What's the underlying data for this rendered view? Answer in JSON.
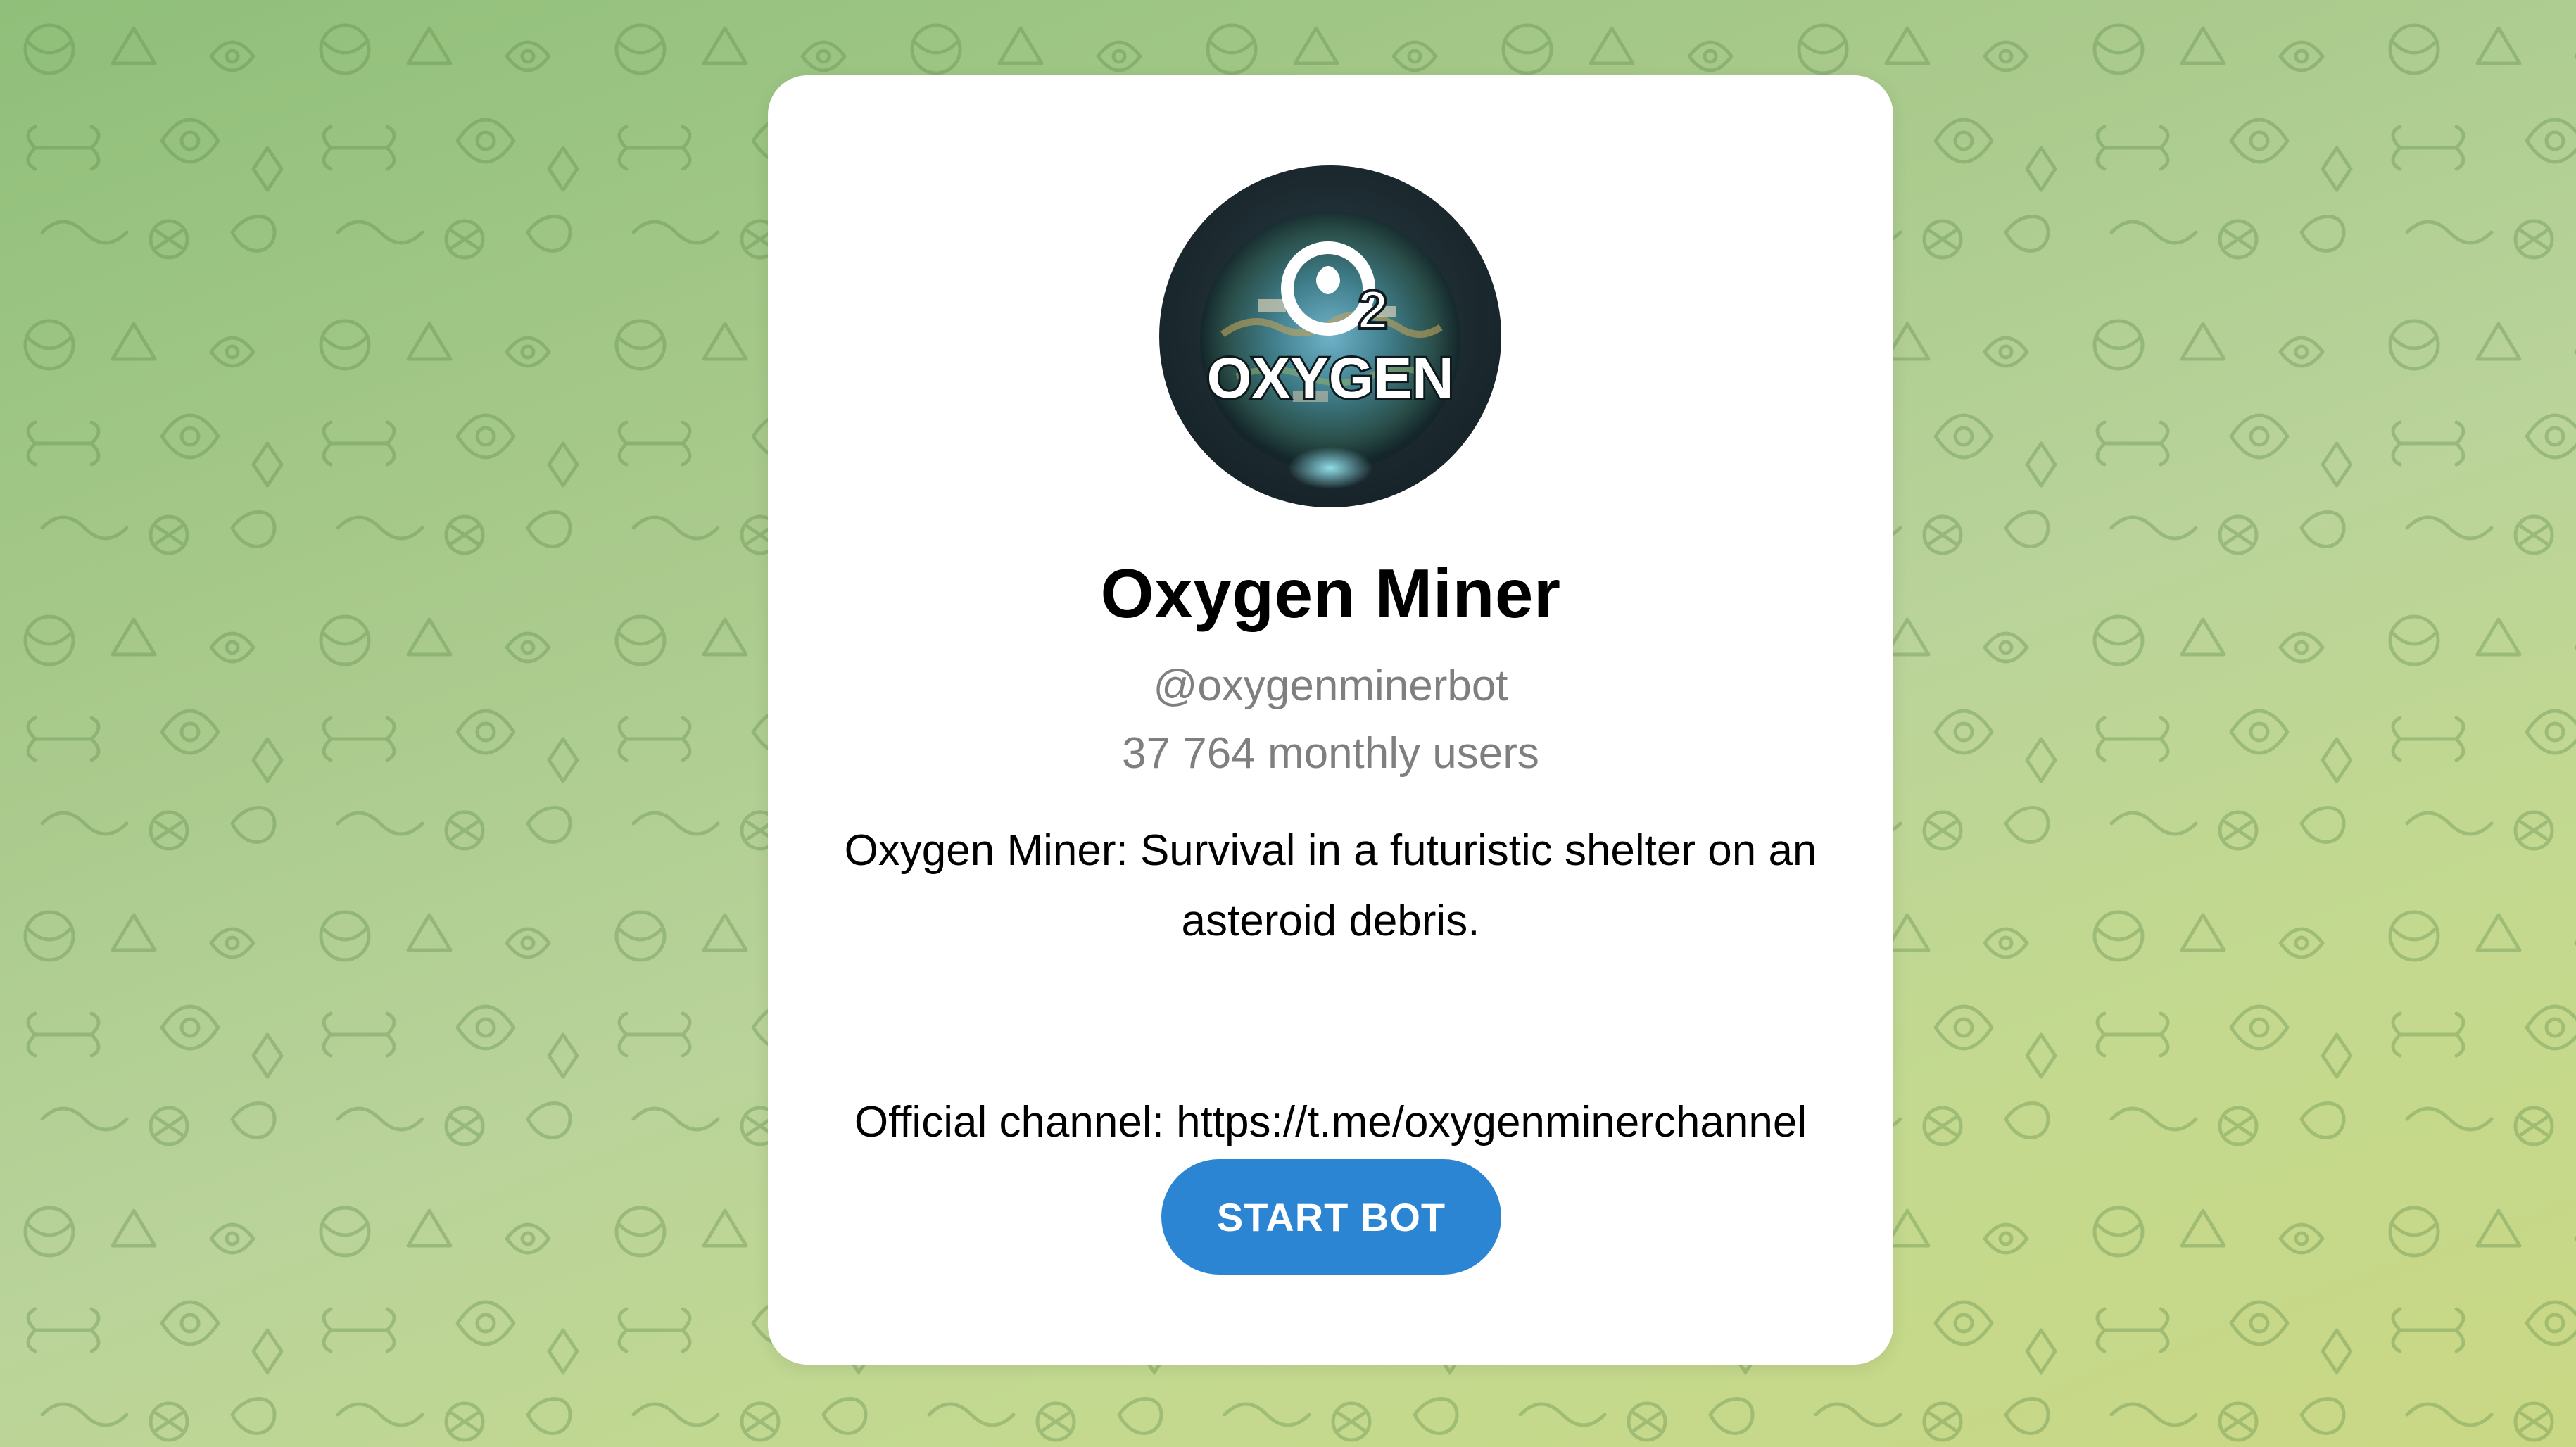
{
  "bot": {
    "avatar_text": "OXYGEN",
    "avatar_logo": "O2",
    "name": "Oxygen Miner",
    "username": "@oxygenminerbot",
    "monthly_users": "37 764 monthly users",
    "description": "Oxygen Miner: Survival in a futuristic shelter on an asteroid debris.",
    "channel_text": "Official channel: https://t.me/oxygenminerchannel"
  },
  "actions": {
    "start_label": "START BOT"
  },
  "colors": {
    "button": "#2b85d3",
    "background_start": "#8fbf7a",
    "background_end": "#c9d884",
    "muted_text": "#7f7f7f"
  },
  "icons": {
    "background": "doodle-pattern-icon"
  }
}
